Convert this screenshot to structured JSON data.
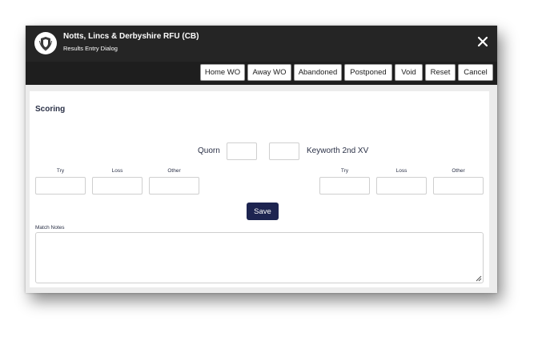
{
  "header": {
    "title": "Notts, Lincs & Derbyshire RFU (CB)",
    "subtitle": "Results Entry Dialog",
    "logo_icon": "crest-icon",
    "close_icon": "close-icon"
  },
  "toolbar": {
    "home_wo": "Home WO",
    "away_wo": "Away WO",
    "abandoned": "Abandoned",
    "postponed": "Postponed",
    "void": "Void",
    "reset": "Reset",
    "cancel": "Cancel"
  },
  "scoring": {
    "heading": "Scoring",
    "home_team": "Quorn",
    "away_team": "Keyworth 2nd XV",
    "home_score": "",
    "away_score": "",
    "labels": {
      "try": "Try",
      "loss": "Loss",
      "other": "Other"
    },
    "home": {
      "try": "",
      "loss": "",
      "other": ""
    },
    "away": {
      "try": "",
      "loss": "",
      "other": ""
    },
    "save_label": "Save"
  },
  "notes": {
    "label": "Match Notes",
    "value": ""
  },
  "colors": {
    "titlebar": "#252525",
    "toolbar": "#1e1e1e",
    "save_button": "#1d2450",
    "text": "#2a3046"
  }
}
